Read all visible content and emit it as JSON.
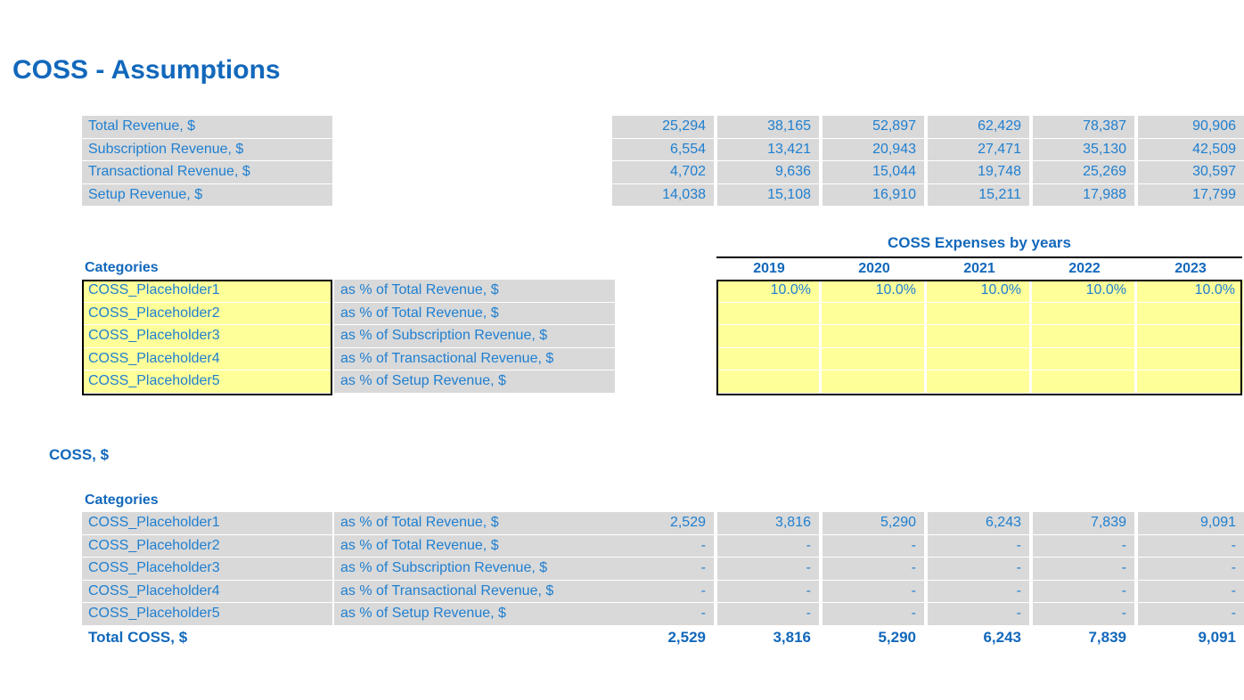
{
  "page": {
    "title": "COSS - Assumptions",
    "accent_blue": "#1268bb",
    "value_blue": "#1f7fd0",
    "gray_cell": "#d9d9d9",
    "yellow_cell": "#ffff99"
  },
  "revenue_block": {
    "rows": [
      {
        "label": "Total Revenue, $",
        "values": [
          "25,294",
          "38,165",
          "52,897",
          "62,429",
          "78,387",
          "90,906"
        ]
      },
      {
        "label": "Subscription Revenue, $",
        "values": [
          "6,554",
          "13,421",
          "20,943",
          "27,471",
          "35,130",
          "42,509"
        ]
      },
      {
        "label": "Transactional Revenue, $",
        "values": [
          "4,702",
          "9,636",
          "15,044",
          "19,748",
          "25,269",
          "30,597"
        ]
      },
      {
        "label": "Setup Revenue, $",
        "values": [
          "14,038",
          "15,108",
          "16,910",
          "15,211",
          "17,988",
          "17,799"
        ]
      }
    ]
  },
  "assumptions_block": {
    "categories_header": "Categories",
    "expenses_title": "COSS Expenses by years",
    "years": [
      "2019",
      "2020",
      "2021",
      "2022",
      "2023"
    ],
    "rows": [
      {
        "category": "COSS_Placeholder1",
        "basis": "as % of Total Revenue, $",
        "percents": [
          "10.0%",
          "10.0%",
          "10.0%",
          "10.0%",
          "10.0%"
        ]
      },
      {
        "category": "COSS_Placeholder2",
        "basis": "as % of Total Revenue, $",
        "percents": [
          "",
          "",
          "",
          "",
          ""
        ]
      },
      {
        "category": "COSS_Placeholder3",
        "basis": "as % of Subscription Revenue, $",
        "percents": [
          "",
          "",
          "",
          "",
          ""
        ]
      },
      {
        "category": "COSS_Placeholder4",
        "basis": "as % of Transactional Revenue, $",
        "percents": [
          "",
          "",
          "",
          "",
          ""
        ]
      },
      {
        "category": "COSS_Placeholder5",
        "basis": "as % of Setup Revenue, $",
        "percents": [
          "",
          "",
          "",
          "",
          ""
        ]
      }
    ]
  },
  "coss_block": {
    "section_title": "COSS, $",
    "categories_header": "Categories",
    "total_label": "Total COSS, $",
    "rows": [
      {
        "category": "COSS_Placeholder1",
        "basis": "as % of Total Revenue, $",
        "values": [
          "2,529",
          "3,816",
          "5,290",
          "6,243",
          "7,839",
          "9,091"
        ]
      },
      {
        "category": "COSS_Placeholder2",
        "basis": "as % of Total Revenue, $",
        "values": [
          "-",
          "-",
          "-",
          "-",
          "-",
          "-"
        ]
      },
      {
        "category": "COSS_Placeholder3",
        "basis": "as % of Subscription Revenue, $",
        "values": [
          "-",
          "-",
          "-",
          "-",
          "-",
          "-"
        ]
      },
      {
        "category": "COSS_Placeholder4",
        "basis": "as % of Transactional Revenue, $",
        "values": [
          "-",
          "-",
          "-",
          "-",
          "-",
          "-"
        ]
      },
      {
        "category": "COSS_Placeholder5",
        "basis": "as % of Setup Revenue, $",
        "values": [
          "-",
          "-",
          "-",
          "-",
          "-",
          "-"
        ]
      }
    ],
    "totals": [
      "2,529",
      "3,816",
      "5,290",
      "6,243",
      "7,839",
      "9,091"
    ]
  }
}
